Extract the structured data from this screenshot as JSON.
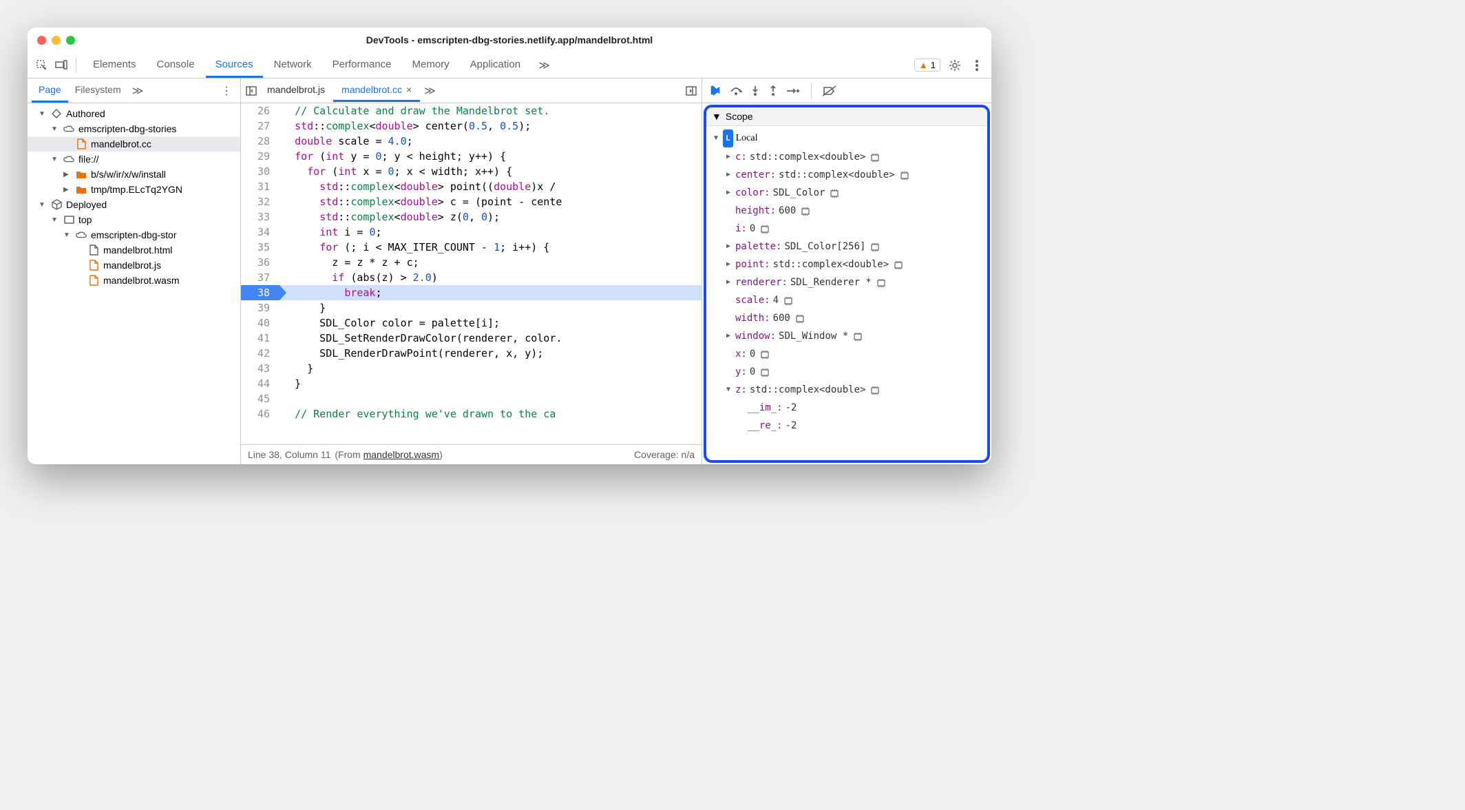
{
  "window": {
    "title": "DevTools - emscripten-dbg-stories.netlify.app/mandelbrot.html"
  },
  "toolbar": {
    "tabs": [
      "Elements",
      "Console",
      "Sources",
      "Network",
      "Performance",
      "Memory",
      "Application"
    ],
    "active": "Sources",
    "overflow_glyph": "≫",
    "warn_count": "1"
  },
  "sidebar": {
    "tabs": [
      "Page",
      "Filesystem"
    ],
    "active": "Page",
    "overflow_glyph": "≫",
    "tree": [
      {
        "depth": 0,
        "expand": "down",
        "icon": "auth",
        "label": "Authored"
      },
      {
        "depth": 1,
        "expand": "down",
        "icon": "cloud",
        "label": "emscripten-dbg-stories"
      },
      {
        "depth": 2,
        "expand": "",
        "icon": "filejs",
        "label": "mandelbrot.cc",
        "selected": true
      },
      {
        "depth": 1,
        "expand": "down",
        "icon": "cloud",
        "label": "file://"
      },
      {
        "depth": 2,
        "expand": "right",
        "icon": "folder",
        "label": "b/s/w/ir/x/w/install"
      },
      {
        "depth": 2,
        "expand": "right",
        "icon": "folder",
        "label": "tmp/tmp.ELcTq2YGN"
      },
      {
        "depth": 0,
        "expand": "down",
        "icon": "box",
        "label": "Deployed"
      },
      {
        "depth": 1,
        "expand": "down",
        "icon": "frame",
        "label": "top"
      },
      {
        "depth": 2,
        "expand": "down",
        "icon": "cloud",
        "label": "emscripten-dbg-stor"
      },
      {
        "depth": 3,
        "expand": "",
        "icon": "file",
        "label": "mandelbrot.html"
      },
      {
        "depth": 3,
        "expand": "",
        "icon": "filejs",
        "label": "mandelbrot.js"
      },
      {
        "depth": 3,
        "expand": "",
        "icon": "filejs",
        "label": "mandelbrot.wasm"
      }
    ]
  },
  "editor": {
    "tabs": [
      {
        "label": "mandelbrot.js",
        "active": false,
        "closable": false
      },
      {
        "label": "mandelbrot.cc",
        "active": true,
        "closable": true
      }
    ],
    "overflow_glyph": "≫",
    "lines": [
      {
        "n": 26,
        "html": "  <span class='c-comment'>// Calculate and draw the Mandelbrot set.</span>"
      },
      {
        "n": 27,
        "html": "  <span class='c-ns'>std</span>::<span class='c-type'>complex</span>&lt;<span class='c-kw'>double</span>&gt; center(<span class='c-num'>0.5</span>, <span class='c-num'>0.5</span>);"
      },
      {
        "n": 28,
        "html": "  <span class='c-kw'>double</span> scale = <span class='c-num'>4.0</span>;"
      },
      {
        "n": 29,
        "html": "  <span class='c-kw'>for</span> (<span class='c-kw'>int</span> y = <span class='c-num'>0</span>; y &lt; height; y++) {"
      },
      {
        "n": 30,
        "html": "    <span class='c-kw'>for</span> (<span class='c-kw'>int</span> x = <span class='c-num'>0</span>; x &lt; width; x++) {"
      },
      {
        "n": 31,
        "html": "      <span class='c-ns'>std</span>::<span class='c-type'>complex</span>&lt;<span class='c-kw'>double</span>&gt; point((<span class='c-kw'>double</span>)x /"
      },
      {
        "n": 32,
        "html": "      <span class='c-ns'>std</span>::<span class='c-type'>complex</span>&lt;<span class='c-kw'>double</span>&gt; c = (point - cente"
      },
      {
        "n": 33,
        "html": "      <span class='c-ns'>std</span>::<span class='c-type'>complex</span>&lt;<span class='c-kw'>double</span>&gt; z(<span class='c-num'>0</span>, <span class='c-num'>0</span>);"
      },
      {
        "n": 34,
        "html": "      <span class='c-kw'>int</span> i = <span class='c-num'>0</span>;"
      },
      {
        "n": 35,
        "html": "      <span class='c-kw'>for</span> (; i &lt; MAX_ITER_COUNT - <span class='c-num'>1</span>; i++) {"
      },
      {
        "n": 36,
        "html": "        z = z * z + c;"
      },
      {
        "n": 37,
        "html": "        <span class='c-kw'>if</span> (abs(z) &gt; <span class='c-num'>2.0</span>)"
      },
      {
        "n": 38,
        "html": "          <span class='c-kw'>break</span>;",
        "bp": true,
        "hl": true
      },
      {
        "n": 39,
        "html": "      }"
      },
      {
        "n": 40,
        "html": "      SDL_Color color = palette[i];"
      },
      {
        "n": 41,
        "html": "      SDL_SetRenderDrawColor(renderer, color."
      },
      {
        "n": 42,
        "html": "      SDL_RenderDrawPoint(renderer, x, y);"
      },
      {
        "n": 43,
        "html": "    }"
      },
      {
        "n": 44,
        "html": "  }"
      },
      {
        "n": 45,
        "html": ""
      },
      {
        "n": 46,
        "html": "  <span class='c-comment'>// Render everything we've drawn to the ca</span>"
      }
    ],
    "status": {
      "position": "Line 38, Column 11",
      "from_label": "(From ",
      "from_source": "mandelbrot.wasm",
      "from_close": ")",
      "coverage": "Coverage: n/a"
    }
  },
  "debugger": {
    "scope_label": "Scope",
    "local_label": "Local",
    "vars": [
      {
        "exp": "right",
        "name": "c",
        "val": "std::complex<double>",
        "mem": true,
        "ind": 0
      },
      {
        "exp": "right",
        "name": "center",
        "val": "std::complex<double>",
        "mem": true,
        "ind": 0
      },
      {
        "exp": "right",
        "name": "color",
        "val": "SDL_Color",
        "mem": true,
        "ind": 0
      },
      {
        "exp": "",
        "name": "height",
        "val": "600",
        "mem": true,
        "ind": 0
      },
      {
        "exp": "",
        "name": "i",
        "val": "0",
        "mem": true,
        "ind": 0
      },
      {
        "exp": "right",
        "name": "palette",
        "val": "SDL_Color[256]",
        "mem": true,
        "ind": 0
      },
      {
        "exp": "right",
        "name": "point",
        "val": "std::complex<double>",
        "mem": true,
        "ind": 0
      },
      {
        "exp": "right",
        "name": "renderer",
        "val": "SDL_Renderer *",
        "mem": true,
        "ind": 0
      },
      {
        "exp": "",
        "name": "scale",
        "val": "4",
        "mem": true,
        "ind": 0
      },
      {
        "exp": "",
        "name": "width",
        "val": "600",
        "mem": true,
        "ind": 0
      },
      {
        "exp": "right",
        "name": "window",
        "val": "SDL_Window *",
        "mem": true,
        "ind": 0
      },
      {
        "exp": "",
        "name": "x",
        "val": "0",
        "mem": true,
        "ind": 0
      },
      {
        "exp": "",
        "name": "y",
        "val": "0",
        "mem": true,
        "ind": 0
      },
      {
        "exp": "down",
        "name": "z",
        "val": "std::complex<double>",
        "mem": true,
        "ind": 0
      },
      {
        "exp": "",
        "name": "__im_",
        "val": "-2",
        "mem": false,
        "ind": 1
      },
      {
        "exp": "",
        "name": "__re_",
        "val": "-2",
        "mem": false,
        "ind": 1
      }
    ]
  }
}
